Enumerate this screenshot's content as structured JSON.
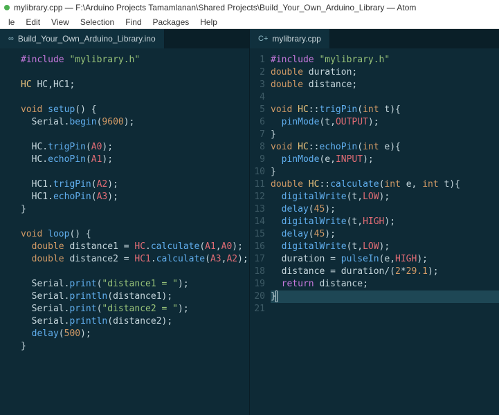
{
  "window": {
    "title": "mylibrary.cpp — F:\\Arduino Projects Tamamlanan\\Shared Projects\\Build_Your_Own_Arduino_Library — Atom"
  },
  "menu": [
    "le",
    "Edit",
    "View",
    "Selection",
    "Find",
    "Packages",
    "Help"
  ],
  "left": {
    "tab_icon": "∞",
    "tab_label": "Build_Your_Own_Arduino_Library.ino",
    "lines": [
      [
        [
          "pp",
          "#include"
        ],
        [
          "id",
          " "
        ],
        [
          "str",
          "\"mylibrary.h\""
        ]
      ],
      [],
      [
        [
          "cls",
          "HC "
        ],
        [
          "id",
          "HC"
        ],
        [
          "id",
          ","
        ],
        [
          "id",
          "HC1"
        ],
        [
          "id",
          ";"
        ]
      ],
      [],
      [
        [
          "kw",
          "void"
        ],
        [
          "id",
          " "
        ],
        [
          "fn",
          "setup"
        ],
        [
          "id",
          "() {"
        ]
      ],
      [
        [
          "id",
          "  Serial."
        ],
        [
          "fn",
          "begin"
        ],
        [
          "id",
          "("
        ],
        [
          "num",
          "9600"
        ],
        [
          "id",
          ");"
        ]
      ],
      [],
      [
        [
          "id",
          "  HC."
        ],
        [
          "fn",
          "trigPin"
        ],
        [
          "id",
          "("
        ],
        [
          "const",
          "A0"
        ],
        [
          "id",
          ");"
        ]
      ],
      [
        [
          "id",
          "  HC."
        ],
        [
          "fn",
          "echoPin"
        ],
        [
          "id",
          "("
        ],
        [
          "const",
          "A1"
        ],
        [
          "id",
          ");"
        ]
      ],
      [],
      [
        [
          "id",
          "  HC1."
        ],
        [
          "fn",
          "trigPin"
        ],
        [
          "id",
          "("
        ],
        [
          "const",
          "A2"
        ],
        [
          "id",
          ");"
        ]
      ],
      [
        [
          "id",
          "  HC1."
        ],
        [
          "fn",
          "echoPin"
        ],
        [
          "id",
          "("
        ],
        [
          "const",
          "A3"
        ],
        [
          "id",
          ");"
        ]
      ],
      [
        [
          "id",
          "}"
        ]
      ],
      [],
      [
        [
          "kw",
          "void"
        ],
        [
          "id",
          " "
        ],
        [
          "fn",
          "loop"
        ],
        [
          "id",
          "() {"
        ]
      ],
      [
        [
          "id",
          "  "
        ],
        [
          "kw",
          "double"
        ],
        [
          "id",
          " distance1 = "
        ],
        [
          "const",
          "HC"
        ],
        [
          "id",
          "."
        ],
        [
          "fn",
          "calculate"
        ],
        [
          "id",
          "("
        ],
        [
          "const",
          "A1"
        ],
        [
          "id",
          ","
        ],
        [
          "const",
          "A0"
        ],
        [
          "id",
          ");"
        ]
      ],
      [
        [
          "id",
          "  "
        ],
        [
          "kw",
          "double"
        ],
        [
          "id",
          " distance2 = "
        ],
        [
          "const",
          "HC1"
        ],
        [
          "id",
          "."
        ],
        [
          "fn",
          "calculate"
        ],
        [
          "id",
          "("
        ],
        [
          "const",
          "A3"
        ],
        [
          "id",
          ","
        ],
        [
          "const",
          "A2"
        ],
        [
          "id",
          ");"
        ]
      ],
      [],
      [
        [
          "id",
          "  Serial."
        ],
        [
          "fn",
          "print"
        ],
        [
          "id",
          "("
        ],
        [
          "str",
          "\"distance1 = \""
        ],
        [
          "id",
          ");"
        ]
      ],
      [
        [
          "id",
          "  Serial."
        ],
        [
          "fn",
          "println"
        ],
        [
          "id",
          "(distance1);"
        ]
      ],
      [
        [
          "id",
          "  Serial."
        ],
        [
          "fn",
          "print"
        ],
        [
          "id",
          "("
        ],
        [
          "str",
          "\"distance2 = \""
        ],
        [
          "id",
          ");"
        ]
      ],
      [
        [
          "id",
          "  Serial."
        ],
        [
          "fn",
          "println"
        ],
        [
          "id",
          "(distance2);"
        ]
      ],
      [
        [
          "id",
          "  "
        ],
        [
          "fn",
          "delay"
        ],
        [
          "id",
          "("
        ],
        [
          "num",
          "500"
        ],
        [
          "id",
          ");"
        ]
      ],
      [
        [
          "id",
          "}"
        ]
      ]
    ]
  },
  "right": {
    "tab_icon": "C+",
    "tab_label": "mylibrary.cpp",
    "line_start": 1,
    "cursor_line": 20,
    "lines": [
      [
        [
          "pp",
          "#include"
        ],
        [
          "id",
          " "
        ],
        [
          "str",
          "\"mylibrary.h\""
        ]
      ],
      [
        [
          "kw",
          "double"
        ],
        [
          "id",
          " duration;"
        ]
      ],
      [
        [
          "kw",
          "double"
        ],
        [
          "id",
          " distance;"
        ]
      ],
      [],
      [
        [
          "kw",
          "void"
        ],
        [
          "id",
          " "
        ],
        [
          "cls",
          "HC"
        ],
        [
          "id",
          "::"
        ],
        [
          "fn",
          "trigPin"
        ],
        [
          "id",
          "("
        ],
        [
          "kw",
          "int"
        ],
        [
          "id",
          " t){"
        ]
      ],
      [
        [
          "id",
          "  "
        ],
        [
          "fn",
          "pinMode"
        ],
        [
          "id",
          "(t,"
        ],
        [
          "const",
          "OUTPUT"
        ],
        [
          "id",
          ");"
        ]
      ],
      [
        [
          "id",
          "}"
        ]
      ],
      [
        [
          "kw",
          "void"
        ],
        [
          "id",
          " "
        ],
        [
          "cls",
          "HC"
        ],
        [
          "id",
          "::"
        ],
        [
          "fn",
          "echoPin"
        ],
        [
          "id",
          "("
        ],
        [
          "kw",
          "int"
        ],
        [
          "id",
          " e){"
        ]
      ],
      [
        [
          "id",
          "  "
        ],
        [
          "fn",
          "pinMode"
        ],
        [
          "id",
          "(e,"
        ],
        [
          "const",
          "INPUT"
        ],
        [
          "id",
          ");"
        ]
      ],
      [
        [
          "id",
          "}"
        ]
      ],
      [
        [
          "kw",
          "double"
        ],
        [
          "id",
          " "
        ],
        [
          "cls",
          "HC"
        ],
        [
          "id",
          "::"
        ],
        [
          "fn",
          "calculate"
        ],
        [
          "id",
          "("
        ],
        [
          "kw",
          "int"
        ],
        [
          "id",
          " e, "
        ],
        [
          "kw",
          "int"
        ],
        [
          "id",
          " t){"
        ]
      ],
      [
        [
          "id",
          "  "
        ],
        [
          "fn",
          "digitalWrite"
        ],
        [
          "id",
          "(t,"
        ],
        [
          "const",
          "LOW"
        ],
        [
          "id",
          ");"
        ]
      ],
      [
        [
          "id",
          "  "
        ],
        [
          "fn",
          "delay"
        ],
        [
          "id",
          "("
        ],
        [
          "num",
          "45"
        ],
        [
          "id",
          ");"
        ]
      ],
      [
        [
          "id",
          "  "
        ],
        [
          "fn",
          "digitalWrite"
        ],
        [
          "id",
          "(t,"
        ],
        [
          "const",
          "HIGH"
        ],
        [
          "id",
          ");"
        ]
      ],
      [
        [
          "id",
          "  "
        ],
        [
          "fn",
          "delay"
        ],
        [
          "id",
          "("
        ],
        [
          "num",
          "45"
        ],
        [
          "id",
          ");"
        ]
      ],
      [
        [
          "id",
          "  "
        ],
        [
          "fn",
          "digitalWrite"
        ],
        [
          "id",
          "(t,"
        ],
        [
          "const",
          "LOW"
        ],
        [
          "id",
          ");"
        ]
      ],
      [
        [
          "id",
          "  duration = "
        ],
        [
          "fn",
          "pulseIn"
        ],
        [
          "id",
          "(e,"
        ],
        [
          "const",
          "HIGH"
        ],
        [
          "id",
          ");"
        ]
      ],
      [
        [
          "id",
          "  distance = duration/("
        ],
        [
          "num",
          "2"
        ],
        [
          "id",
          "*"
        ],
        [
          "num",
          "29.1"
        ],
        [
          "id",
          ");"
        ]
      ],
      [
        [
          "id",
          "  "
        ],
        [
          "return",
          "return"
        ],
        [
          "id",
          " distance;"
        ]
      ],
      [
        [
          "id",
          "}"
        ],
        [
          "cursor",
          ""
        ]
      ],
      []
    ]
  }
}
